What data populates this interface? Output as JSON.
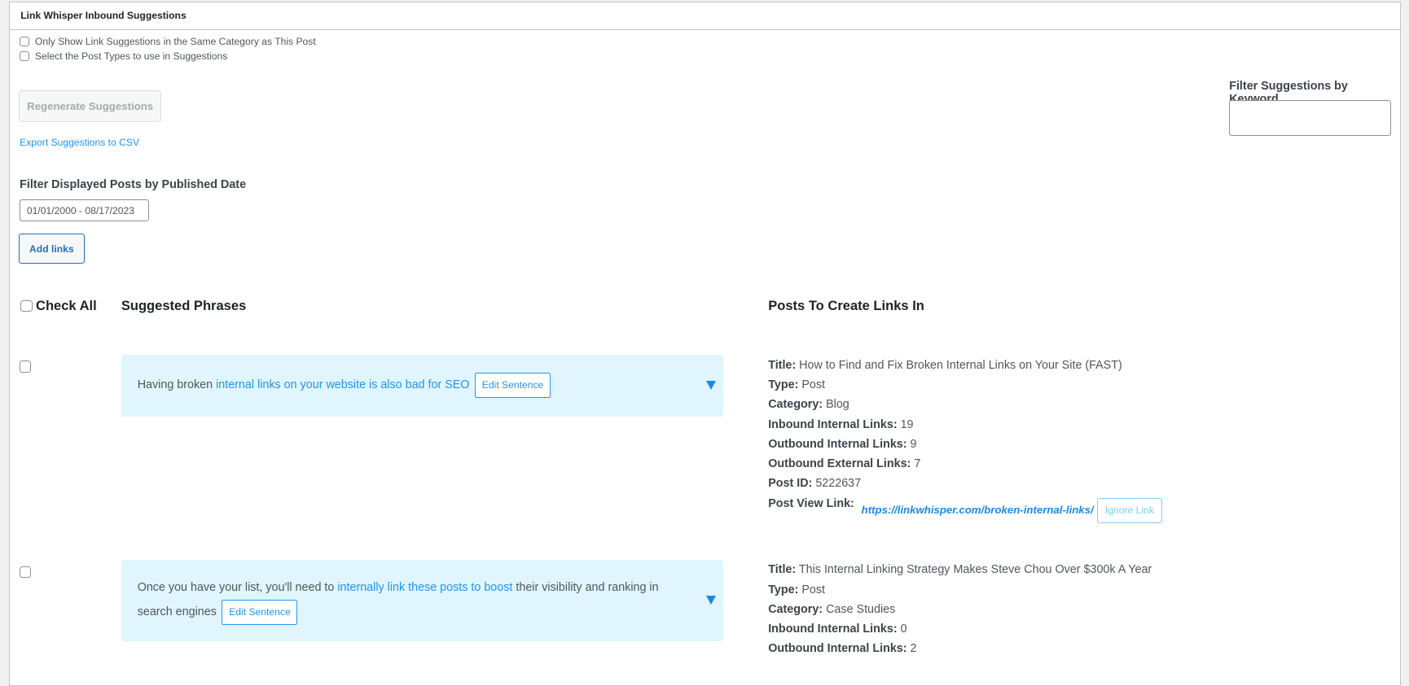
{
  "panel": {
    "title": "Link Whisper Inbound Suggestions"
  },
  "options": {
    "same_category": "Only Show Link Suggestions in the Same Category as This Post",
    "post_types": "Select the Post Types to use in Suggestions"
  },
  "buttons": {
    "regenerate": "Regenerate Suggestions",
    "export": "Export Suggestions to CSV",
    "add_links": "Add links",
    "edit_sentence": "Edit Sentence",
    "ignore_link": "Ignore Link"
  },
  "date_filter": {
    "label": "Filter Displayed Posts by Published Date",
    "value": "01/01/2000 - 08/17/2023"
  },
  "keyword_filter": {
    "label": "Filter Suggestions by Keyword",
    "value": ""
  },
  "table": {
    "check_all": "Check All",
    "col_phrases": "Suggested Phrases",
    "col_posts": "Posts To Create Links In"
  },
  "labels": {
    "title": "Title:",
    "type": "Type:",
    "category": "Category:",
    "inbound": "Inbound Internal Links:",
    "outbound_int": "Outbound Internal Links:",
    "outbound_ext": "Outbound External Links:",
    "post_id": "Post ID:",
    "view_link": "Post View Link:"
  },
  "rows": [
    {
      "pre": "Having broken ",
      "link": "internal links on your website is also bad for SEO",
      "post": "",
      "title": "How to Find and Fix Broken Internal Links on Your Site (FAST)",
      "type": "Post",
      "category": "Blog",
      "inbound": "19",
      "outbound_int": "9",
      "outbound_ext": "7",
      "post_id": "5222637",
      "url": "https://linkwhisper.com/broken-internal-links/"
    },
    {
      "pre": "Once you have your list, you'll need to ",
      "link": "internally link these posts to boost",
      "post": " their visibility and ranking in search engines",
      "title": "This Internal Linking Strategy Makes Steve Chou Over $300k A Year",
      "type": "Post",
      "category": "Case Studies",
      "inbound": "0",
      "outbound_int": "2"
    }
  ],
  "colors": {
    "accent": "#2196f3",
    "phrase_bg": "#e0f5fd",
    "button_border": "#2271b1"
  }
}
